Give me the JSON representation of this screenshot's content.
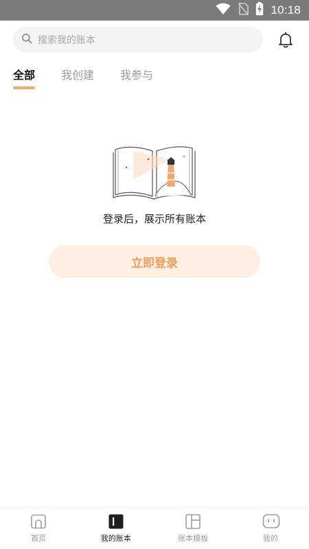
{
  "status_bar": {
    "time": "10:18"
  },
  "search": {
    "placeholder": "搜索我的账本"
  },
  "tabs": [
    {
      "label": "全部",
      "active": true
    },
    {
      "label": "我创建",
      "active": false
    },
    {
      "label": "我参与",
      "active": false
    }
  ],
  "empty_state": {
    "illustration": "open-book-lighthouse-illustration",
    "message": "登录后，展示所有账本",
    "login_button": "立即登录"
  },
  "bottom_nav": [
    {
      "label": "首页",
      "icon": "home-icon",
      "active": false
    },
    {
      "label": "我的账本",
      "icon": "ledger-icon",
      "active": true
    },
    {
      "label": "账本模板",
      "icon": "template-icon",
      "active": false
    },
    {
      "label": "我的",
      "icon": "profile-face-icon",
      "active": false
    }
  ],
  "colors": {
    "accent": "#f0a15e",
    "login_button_bg": "#fdf0e3",
    "login_button_text": "#e9a05c",
    "status_bar_bg": "#7b7b7b"
  }
}
